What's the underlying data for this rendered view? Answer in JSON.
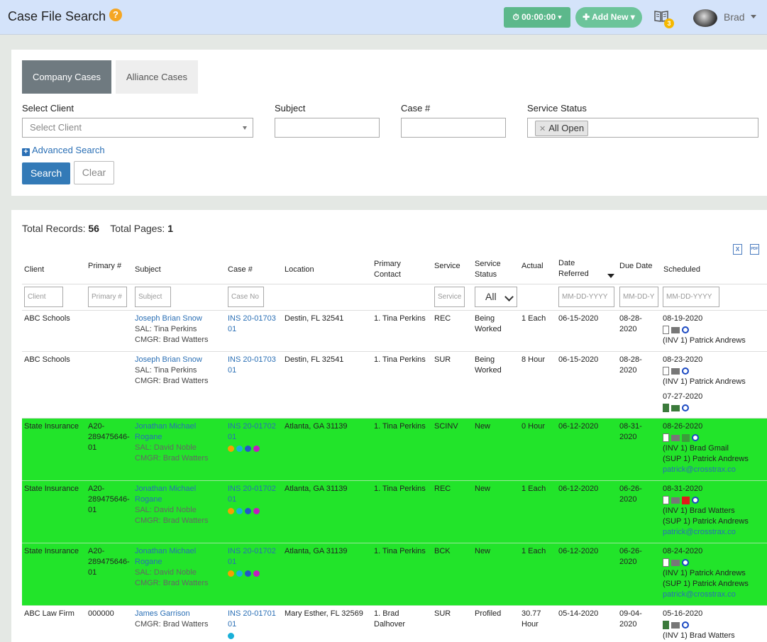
{
  "header": {
    "title": "Case File Search",
    "help_glyph": "?",
    "timer_label": "⏱ 00:00:00 ▾",
    "add_new_label": "✚ Add New ▾",
    "notification_count": "3",
    "user_name": "Brad"
  },
  "tabs": {
    "company": "Company Cases",
    "alliance": "Alliance Cases"
  },
  "search": {
    "client_label": "Select Client",
    "client_placeholder": "Select Client",
    "subject_label": "Subject",
    "case_label": "Case #",
    "status_label": "Service Status",
    "status_chip": "All Open",
    "advanced_label": "Advanced Search",
    "search_button": "Search",
    "clear_button": "Clear"
  },
  "results": {
    "total_records_label": "Total Records:",
    "total_records": "56",
    "total_pages_label": "Total Pages:",
    "total_pages": "1",
    "export_excel": "X",
    "export_pdf": "PDF"
  },
  "table": {
    "headers": {
      "client": "Client",
      "primary": "Primary #",
      "subject": "Subject",
      "case": "Case #",
      "location": "Location",
      "contact_1": "Primary",
      "contact_2": "Contact",
      "service": "Service",
      "status_1": "Service",
      "status_2": "Status",
      "actual": "Actual",
      "referred_1": "Date",
      "referred_2": "Referred",
      "due": "Due Date",
      "scheduled": "Scheduled"
    },
    "filters": {
      "client": "Client",
      "primary": "Primary #",
      "subject": "Subject",
      "case": "Case No",
      "service": "Service",
      "status": "All",
      "date_referred": "MM-DD-YYYY",
      "due": "MM-DD-Y",
      "scheduled": "MM-DD-YYYY"
    },
    "rows": [
      {
        "client": "ABC Schools",
        "primary": "",
        "subject_name": "Joseph Brian Snow",
        "sal": "SAL: Tina Perkins",
        "cmgr": "CMGR: Brad Watters",
        "case_1": "INS 20-01703",
        "case_2": "01",
        "location": "Destin, FL 32541",
        "contact_1": "1. Tina Perkins",
        "contact_2": "",
        "service": "REC",
        "status_1": "Being",
        "status_2": "Worked",
        "actual_1": "1 Each",
        "actual_2": "",
        "referred": "06-15-2020",
        "due_1": "08-28-",
        "due_2": "2020",
        "sched_1_date": "08-19-2020",
        "sched_1_line1": "(INV 1) Patrick Andrews"
      },
      {
        "client": "ABC Schools",
        "primary": "",
        "subject_name": "Joseph Brian Snow",
        "sal": "SAL: Tina Perkins",
        "cmgr": "CMGR: Brad Watters",
        "case_1": "INS 20-01703",
        "case_2": "01",
        "location": "Destin, FL 32541",
        "contact_1": "1. Tina Perkins",
        "contact_2": "",
        "service": "SUR",
        "status_1": "Being",
        "status_2": "Worked",
        "actual_1": "8 Hour",
        "actual_2": "",
        "referred": "06-15-2020",
        "due_1": "08-28-",
        "due_2": "2020",
        "sched_1_date": "08-23-2020",
        "sched_1_line1": "(INV 1) Patrick Andrews",
        "sched_2_date": "07-27-2020"
      },
      {
        "client": "State Insurance",
        "primary_1": "A20-",
        "primary_2": "289475646-",
        "primary_3": "01",
        "subject_1": "Jonathan Michael",
        "subject_2": "Rogane",
        "sal": "SAL: David Noble",
        "cmgr": "CMGR: Brad Watters",
        "case_1": "INS 20-01702",
        "case_2": "01",
        "location": "Atlanta, GA 31139",
        "contact_1": "1. Tina Perkins",
        "service": "SCINV",
        "status_1": "New",
        "actual_1": "0 Hour",
        "referred": "06-12-2020",
        "due_1": "08-31-",
        "due_2": "2020",
        "sched_1_date": "08-26-2020",
        "sched_1_line1": "(INV 1) Brad Gmail",
        "sched_1_line2": "(SUP 1) Patrick Andrews",
        "sched_1_email": "patrick@crosstrax.co"
      },
      {
        "client": "State Insurance",
        "primary_1": "A20-",
        "primary_2": "289475646-",
        "primary_3": "01",
        "subject_1": "Jonathan Michael",
        "subject_2": "Rogane",
        "sal": "SAL: David Noble",
        "cmgr": "CMGR: Brad Watters",
        "case_1": "INS 20-01702",
        "case_2": "01",
        "location": "Atlanta, GA 31139",
        "contact_1": "1. Tina Perkins",
        "service": "REC",
        "status_1": "New",
        "actual_1": "1 Each",
        "referred": "06-12-2020",
        "due_1": "06-26-",
        "due_2": "2020",
        "sched_1_date": "08-31-2020",
        "sched_1_line1": "(INV 1) Brad Watters",
        "sched_1_line2": "(SUP 1) Patrick Andrews",
        "sched_1_email": "patrick@crosstrax.co"
      },
      {
        "client": "State Insurance",
        "primary_1": "A20-",
        "primary_2": "289475646-",
        "primary_3": "01",
        "subject_1": "Jonathan Michael",
        "subject_2": "Rogane",
        "sal": "SAL: David Noble",
        "cmgr": "CMGR: Brad Watters",
        "case_1": "INS 20-01702",
        "case_2": "01",
        "location": "Atlanta, GA 31139",
        "contact_1": "1. Tina Perkins",
        "service": "BCK",
        "status_1": "New",
        "actual_1": "1 Each",
        "referred": "06-12-2020",
        "due_1": "06-26-",
        "due_2": "2020",
        "sched_1_date": "08-24-2020",
        "sched_1_line1": "(INV 1) Patrick Andrews",
        "sched_1_line2": "(SUP 1) Patrick Andrews",
        "sched_1_email": "patrick@crosstrax.co"
      },
      {
        "client": "ABC Law Firm",
        "primary": "000000",
        "subject_name": "James Garrison",
        "cmgr": "CMGR: Brad Watters",
        "case_1": "INS 20-01701",
        "case_2": "01",
        "location": "Mary Esther, FL 32569",
        "contact_1": "1. Brad",
        "contact_2": "Dalhover",
        "service": "SUR",
        "status_1": "Profiled",
        "actual_1": "30.77",
        "actual_2": "Hour",
        "referred": "05-14-2020",
        "due_1": "09-04-",
        "due_2": "2020",
        "sched_1_date": "05-16-2020",
        "sched_1_line1": "(INV 1) Brad Watters"
      }
    ]
  },
  "colors": {
    "highlight_row": "#22e42a",
    "link": "#2a6fb5",
    "overdue": "#d8262b",
    "dot_orange": "#f5a000",
    "dot_cyan": "#1ab0d8",
    "dot_blue": "#2457c9",
    "dot_magenta": "#c21bc2"
  }
}
